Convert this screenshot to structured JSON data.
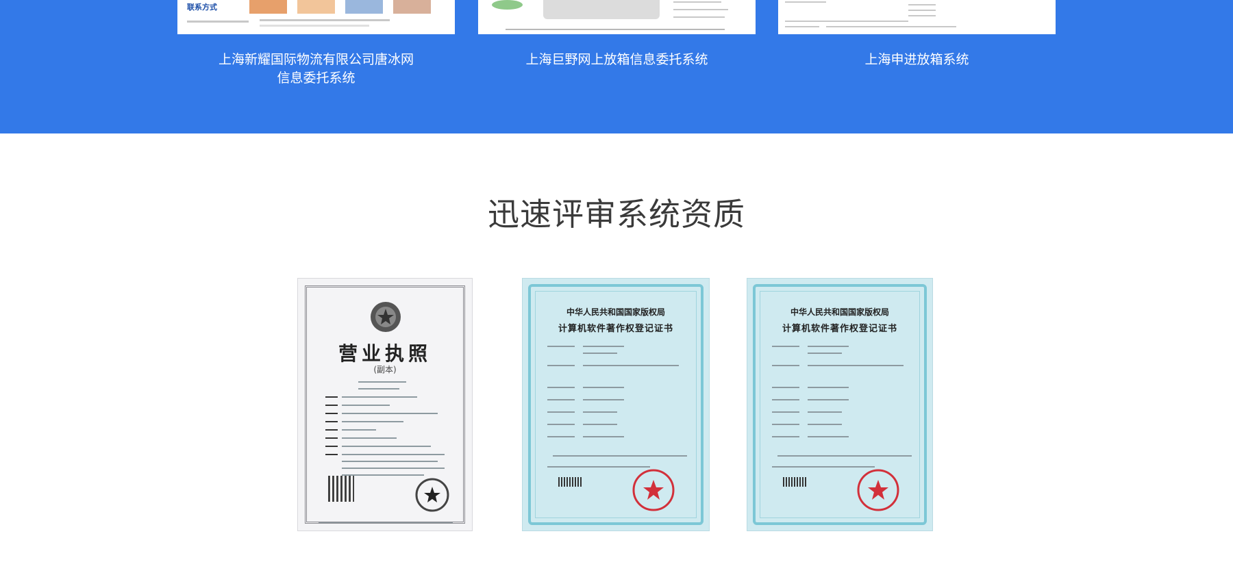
{
  "case_studies": [
    {
      "title_line1": "上海新耀国际物流有限公司唐冰网",
      "title_line2": "信息委托系统",
      "thumb_label": "联系方式"
    },
    {
      "title_line1": "上海巨野网上放箱信息委托系统",
      "title_line2": ""
    },
    {
      "title_line1": "上海申进放箱系统",
      "title_line2": ""
    }
  ],
  "section": {
    "title": "迅速评审系统资质"
  },
  "certificates": [
    {
      "kind": "business-license",
      "heading": "营业执照",
      "subheading": "(副本)"
    },
    {
      "kind": "software-copyright",
      "org": "中华人民共和国国家版权局",
      "heading": "计算机软件著作权登记证书"
    },
    {
      "kind": "software-copyright",
      "org": "中华人民共和国国家版权局",
      "heading": "计算机软件著作权登记证书"
    }
  ],
  "colors": {
    "band": "#3379e8",
    "title": "#3a3a3a",
    "cert_blue": "#cfeaf0",
    "seal_red": "#d2303a"
  }
}
